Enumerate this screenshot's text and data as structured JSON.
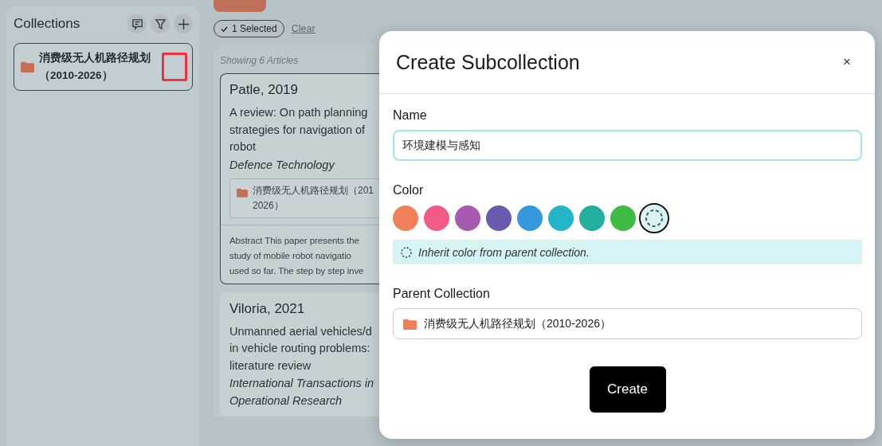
{
  "sidebar": {
    "title": "Collections",
    "collections": [
      {
        "name": "消费级无人机路径规划（2010-2026）",
        "selected": true
      }
    ]
  },
  "toolbar": {
    "selection": "1 Selected",
    "clear": "Clear"
  },
  "articles": {
    "count_label": "Showing 6 Articles",
    "items": [
      {
        "heading": "Patle, 2019",
        "title_lines": [
          "A review: On path planning",
          "strategies for navigation of",
          "robot"
        ],
        "journal_lines": [
          "Defence Technology"
        ],
        "collection_lines": [
          "消费级无人机路径规划（201",
          "2026）"
        ],
        "abstract_lines": [
          "Abstract This paper presents the",
          "study of mobile robot navigatio",
          "used so far. The step by step inve"
        ],
        "selected": true
      },
      {
        "heading": "Viloria, 2021",
        "title_lines": [
          "Unmanned aerial vehicles/d",
          "in vehicle routing problems:",
          "literature review"
        ],
        "journal_lines": [
          "International Transactions in",
          "Operational Research"
        ],
        "selected": false
      }
    ]
  },
  "dialog": {
    "title": "Create Subcollection",
    "close": "×",
    "name_label": "Name",
    "name_value": "环境建模与感知",
    "color_label": "Color",
    "swatches": [
      {
        "kind": "color",
        "color": "#f08058",
        "selected": false
      },
      {
        "kind": "color",
        "color": "#f45a87",
        "selected": false
      },
      {
        "kind": "color",
        "color": "#a65bb0",
        "selected": false
      },
      {
        "kind": "color",
        "color": "#6a5aae",
        "selected": false
      },
      {
        "kind": "color",
        "color": "#3598dc",
        "selected": false
      },
      {
        "kind": "color",
        "color": "#22b6c8",
        "selected": false
      },
      {
        "kind": "color",
        "color": "#24ae9e",
        "selected": false
      },
      {
        "kind": "color",
        "color": "#3dbb44",
        "selected": false
      },
      {
        "kind": "inherit",
        "selected": true
      }
    ],
    "color_hint": "Inherit color from parent collection.",
    "parent_label": "Parent Collection",
    "parent_value": "消费级无人机路径规划（2010-2026）",
    "submit": "Create"
  }
}
